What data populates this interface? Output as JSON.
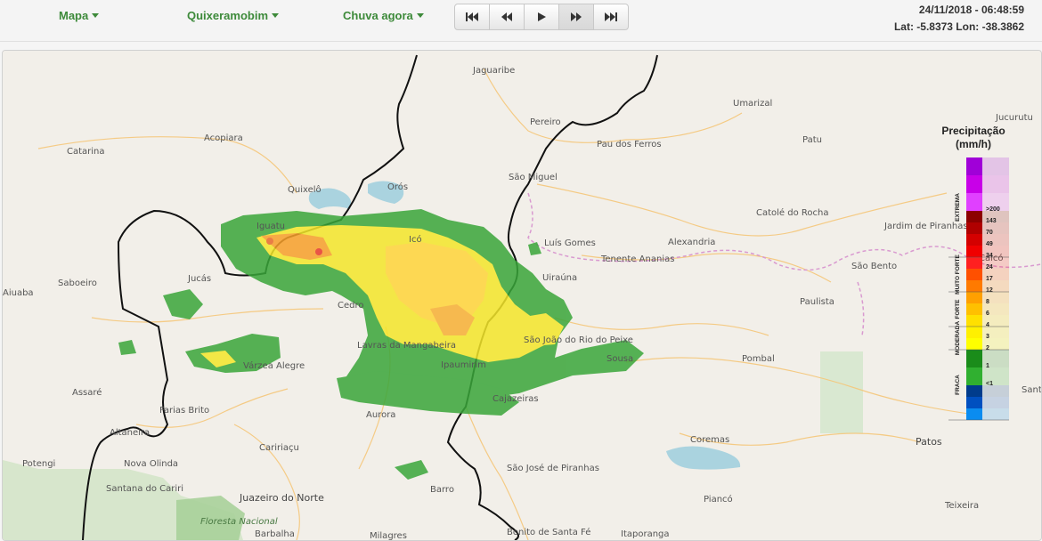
{
  "toolbar": {
    "menu_map": "Mapa",
    "menu_location": "Quixeramobim",
    "menu_layer": "Chuva agora",
    "player": {
      "icons": [
        "skip-first-icon",
        "step-back-icon",
        "play-icon",
        "step-forward-icon",
        "skip-last-icon"
      ]
    },
    "datetime": "24/11/2018 - 06:48:59",
    "coords": "Lat: -5.8373 Lon: -38.3862"
  },
  "map": {
    "places": [
      "Jaguaribe",
      "Pereiro",
      "Umarizal",
      "Jucurutu",
      "Acopiara",
      "Catarina",
      "Pau dos Ferros",
      "Patu",
      "Quixelô",
      "Orós",
      "São Miguel",
      "Catolé do Rocha",
      "Iguatu",
      "Icó",
      "Luís Gomes",
      "Alexandria",
      "Jardim de Piranhas",
      "Tenente Ananias",
      "São Bento",
      "Saboeiro",
      "Jucás",
      "Cedro",
      "Uiraúna",
      "Paulista",
      "Lavras da Mangabeira",
      "Ipaumirim",
      "São João do Rio do Peixe",
      "Sousa",
      "Pombal",
      "Várzea Alegre",
      "Assaré",
      "Farias Brito",
      "Cajazeiras",
      "Aurora",
      "Coremas",
      "Patos",
      "Altaneira",
      "Caririaçu",
      "Potengi",
      "Nova Olinda",
      "São José de Piranhas",
      "Santana do Cariri",
      "Juazeiro do Norte",
      "Barro",
      "Piancó",
      "Teixeira",
      "Floresta Nacional",
      "Barbalha",
      "Milagres",
      "Bonito de Santa Fé",
      "Itaporanga",
      "Aiuaba",
      "Caicó",
      "Santa"
    ]
  },
  "legend": {
    "title_line1": "Precipitação",
    "title_line2": "(mm/h)",
    "categories": [
      "EXTREMA",
      "MUITO FORTE",
      "FORTE",
      "MODERADA",
      "FRACA"
    ],
    "values": [
      ">200",
      "143",
      "70",
      "49",
      "34",
      "24",
      "17",
      "12",
      "8",
      "6",
      "4",
      "3",
      "2",
      "1",
      "<1"
    ],
    "colors": [
      "#a000d8",
      "#c800e8",
      "#e040ff",
      "#8c0000",
      "#b00000",
      "#d40000",
      "#f00000",
      "#ff2020",
      "#ff5000",
      "#ff7a00",
      "#ffa000",
      "#ffc000",
      "#ffe000",
      "#fff000",
      "#ffff00",
      "#1a8c1a",
      "#30b030",
      "#003c8c",
      "#0050c0",
      "#0a8cf0"
    ]
  }
}
